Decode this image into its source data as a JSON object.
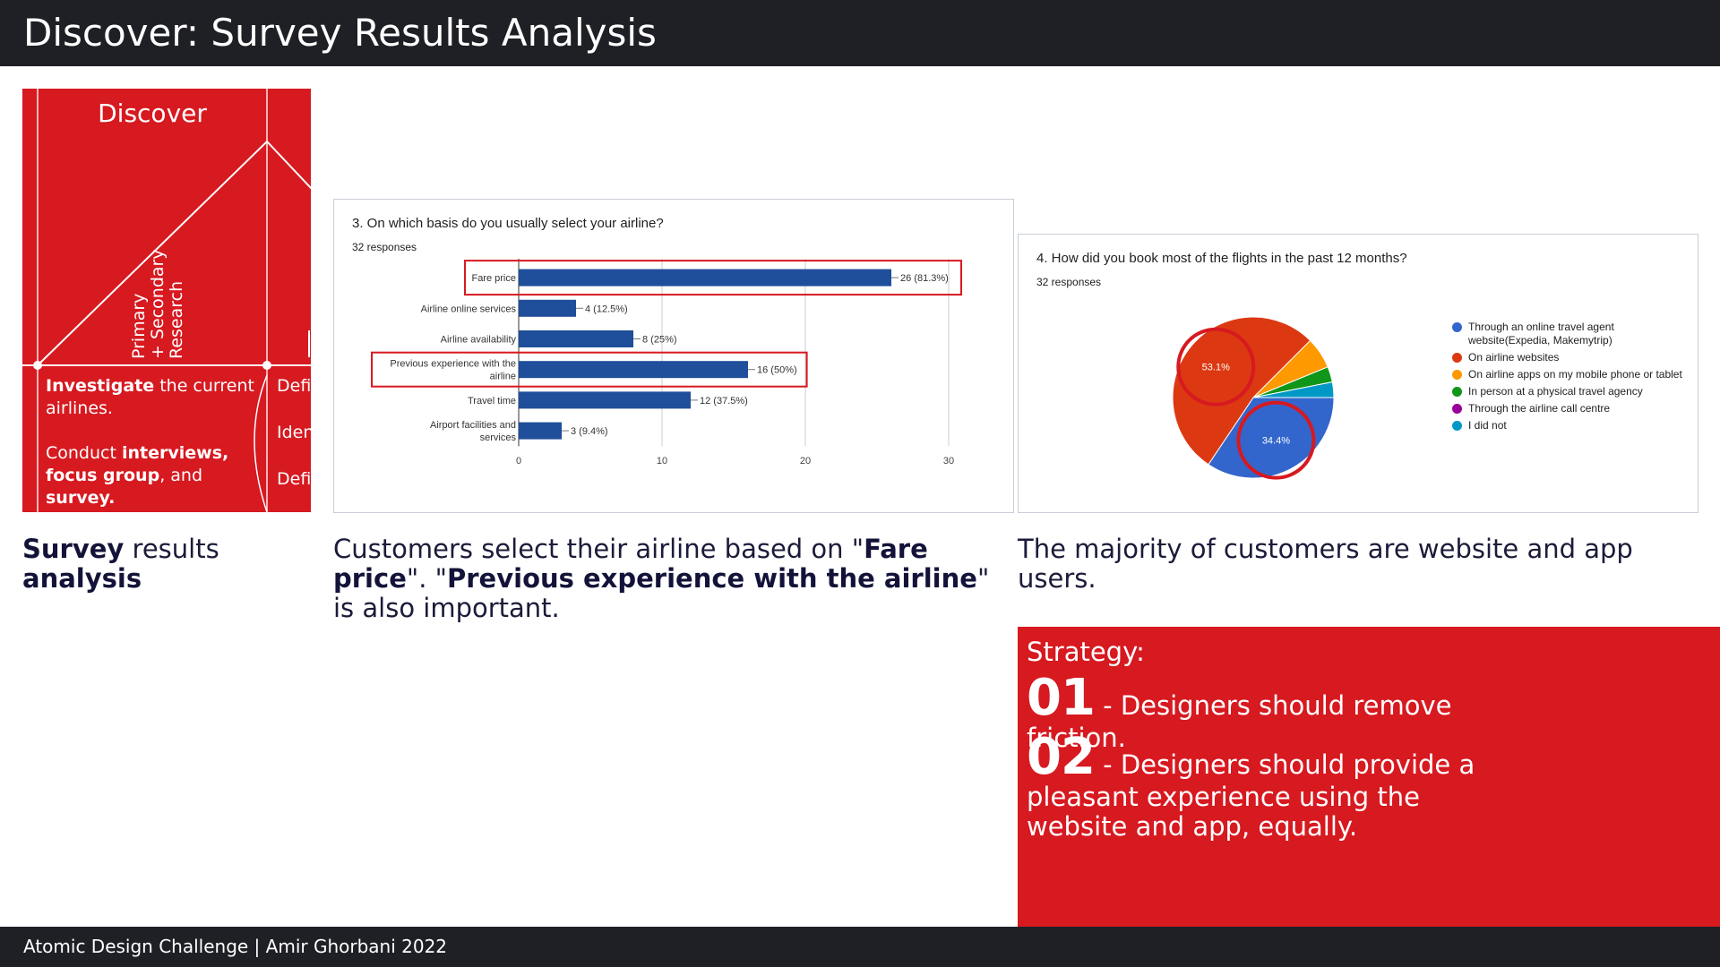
{
  "header": {
    "title": "Discover: Survey Results Analysis"
  },
  "footer": {
    "text": "Atomic Design Challenge | Amir Ghorbani 2022"
  },
  "double_diamond": {
    "label": "Discover",
    "rotated_line1": "Primary",
    "rotated_line2": "+ Secondary",
    "rotated_line3": "Research",
    "body_1_bold": "Investigate",
    "body_1_rest": " the current airlines.",
    "body_2_a": "Conduct ",
    "body_2_bold1": "interviews,",
    "body_2_bold2": "focus group",
    "body_2_b": ", and ",
    "body_2_bold3": "survey.",
    "right_1": "Defi",
    "right_2": "Iden",
    "right_3": "Defi",
    "colors": {
      "panel": "#d71920"
    }
  },
  "captions": {
    "left_bold1": "Survey",
    "left_mid": " results ",
    "left_bold2": "analysis",
    "center_a": "Customers select their airline based on \"",
    "center_bold1": "Fare price",
    "center_b": "\". \"",
    "center_bold2": "Previous experience with the airline",
    "center_c": "\" is also important.",
    "right": "The majority of customers are website and app users."
  },
  "chart_data": [
    {
      "type": "bar",
      "title": "3. On which basis do you usually select your airline?",
      "subtitle": "32 responses",
      "categories": [
        "Fare price",
        "Airline online services",
        "Airline availability",
        "Previous experience with the airline",
        "Travel time",
        "Airport facilities and services"
      ],
      "values": [
        26,
        4,
        8,
        16,
        12,
        3
      ],
      "data_labels": [
        "26 (81.3%)",
        "4 (12.5%)",
        "8 (25%)",
        "16 (50%)",
        "12 (37.5%)",
        "3 (9.4%)"
      ],
      "highlighted": [
        "Fare price",
        "Previous experience with the airline"
      ],
      "xlim": [
        0,
        30
      ],
      "xticks": [
        0,
        10,
        20,
        30
      ],
      "grid": true,
      "bar_color": "#1f4e9a",
      "highlight_color": "#d71920"
    },
    {
      "type": "pie",
      "title": "4. How did you book most of the flights in the past 12 months?",
      "subtitle": "32 responses",
      "slices": [
        {
          "label": "Through an online travel agent website(Expedia, Makemytrip)",
          "value": 34.4,
          "color": "#3366cc",
          "display": "34.4%"
        },
        {
          "label": "On airline websites",
          "value": 53.1,
          "color": "#dc3912",
          "display": "53.1%"
        },
        {
          "label": "On airline apps on my mobile phone or tablet",
          "value": 6.3,
          "color": "#ff9900",
          "display": ""
        },
        {
          "label": "In person at a physical travel agency",
          "value": 3.1,
          "color": "#109618",
          "display": ""
        },
        {
          "label": "Through the airline call centre",
          "value": 0,
          "color": "#990099",
          "display": ""
        },
        {
          "label": "I did not",
          "value": 3.1,
          "color": "#0099c6",
          "display": ""
        }
      ],
      "highlighted": [
        "53.1%",
        "34.4%"
      ],
      "legend": "right"
    }
  ],
  "strategy": {
    "heading": "Strategy:",
    "item1_num": "01",
    "item1_text": " - Designers should remove friction.",
    "item2_num": "02",
    "item2_text": " - Designers should provide a pleasant experience using the website and app, equally."
  }
}
